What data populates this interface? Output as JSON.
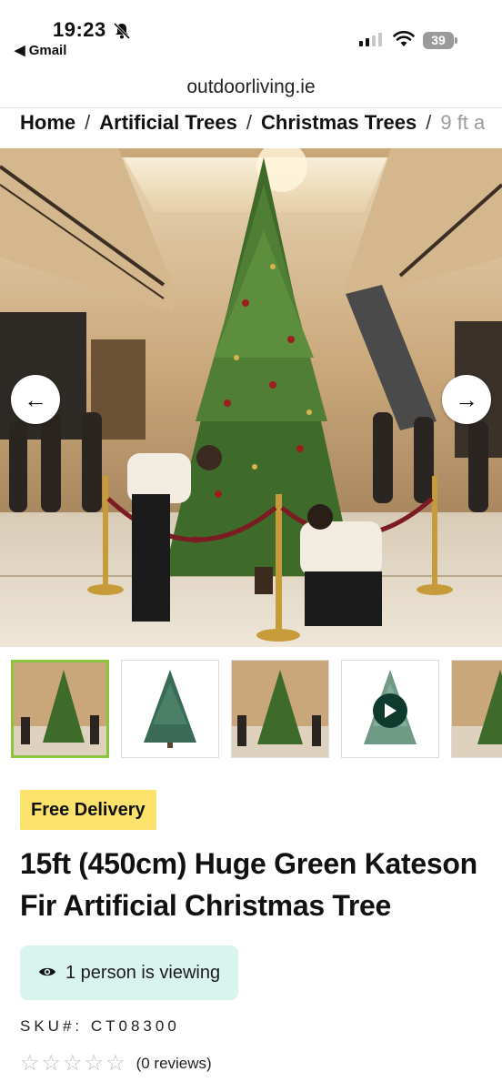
{
  "status_bar": {
    "time": "19:23",
    "back_app": "◀ Gmail",
    "battery": "39"
  },
  "browser": {
    "url": "outdoorliving.ie"
  },
  "breadcrumb": {
    "items": [
      "Home",
      "Artificial Trees",
      "Christmas Trees"
    ],
    "current": "9 ft a",
    "separator": "/"
  },
  "gallery": {
    "prev_icon": "arrow-left-icon",
    "next_icon": "arrow-right-icon",
    "prev_glyph": "←",
    "next_glyph": "→",
    "thumbnails": [
      "mall-tree-photo",
      "tree-cutout",
      "mall-tree-photo",
      "tree-video",
      "mall-tree-photo"
    ]
  },
  "product": {
    "badge": "Free Delivery",
    "title": "15ft (450cm) Huge Green Kateson Fir Artificial Christmas Tree",
    "viewing": "1 person is viewing",
    "sku": "SKU#:  CT08300",
    "rating": 0,
    "reviews": "(0 reviews)"
  },
  "colors": {
    "badge_bg": "#fbe36b",
    "viewing_bg": "#d9f3ef",
    "thumb_active_border": "#8bc53f"
  }
}
